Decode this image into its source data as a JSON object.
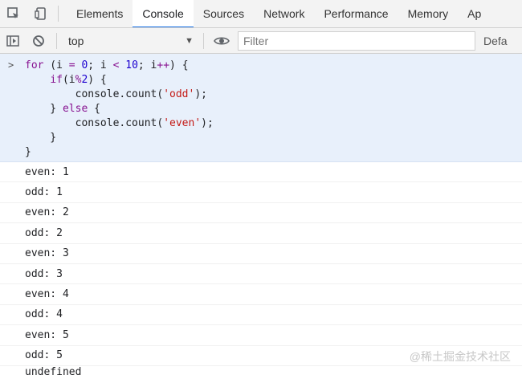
{
  "tabs": {
    "items": [
      {
        "label": "Elements",
        "active": false
      },
      {
        "label": "Console",
        "active": true
      },
      {
        "label": "Sources",
        "active": false
      },
      {
        "label": "Network",
        "active": false
      },
      {
        "label": "Performance",
        "active": false
      },
      {
        "label": "Memory",
        "active": false
      },
      {
        "label": "Ap",
        "active": false
      }
    ]
  },
  "toolbar": {
    "context": "top",
    "filter_placeholder": "Filter",
    "levels_label": "Defa"
  },
  "console": {
    "prompt_symbol": ">",
    "code": {
      "line1_kw": "for",
      "line1_a": " (i ",
      "line1_op1": "=",
      "line1_b": " ",
      "line1_num1": "0",
      "line1_c": "; i ",
      "line1_op2": "<",
      "line1_d": " ",
      "line1_num2": "10",
      "line1_e": "; i",
      "line1_op3": "++",
      "line1_f": ") {",
      "line2_indent": "    ",
      "line2_kw": "if",
      "line2_a": "(i",
      "line2_op": "%",
      "line2_num": "2",
      "line2_b": ") {",
      "line3_a": "        console.count(",
      "line3_str": "'odd'",
      "line3_b": ");",
      "line4_a": "    } ",
      "line4_kw": "else",
      "line4_b": " {",
      "line5_a": "        console.count(",
      "line5_str": "'even'",
      "line5_b": ");",
      "line6": "    }",
      "line7": "}"
    },
    "log_rows": [
      "even: 1",
      "odd: 1",
      "even: 2",
      "odd: 2",
      "even: 3",
      "odd: 3",
      "even: 4",
      "odd: 4",
      "even: 5",
      "odd: 5"
    ],
    "cut_row": "undefined"
  },
  "watermark": "@稀土掘金技术社区"
}
